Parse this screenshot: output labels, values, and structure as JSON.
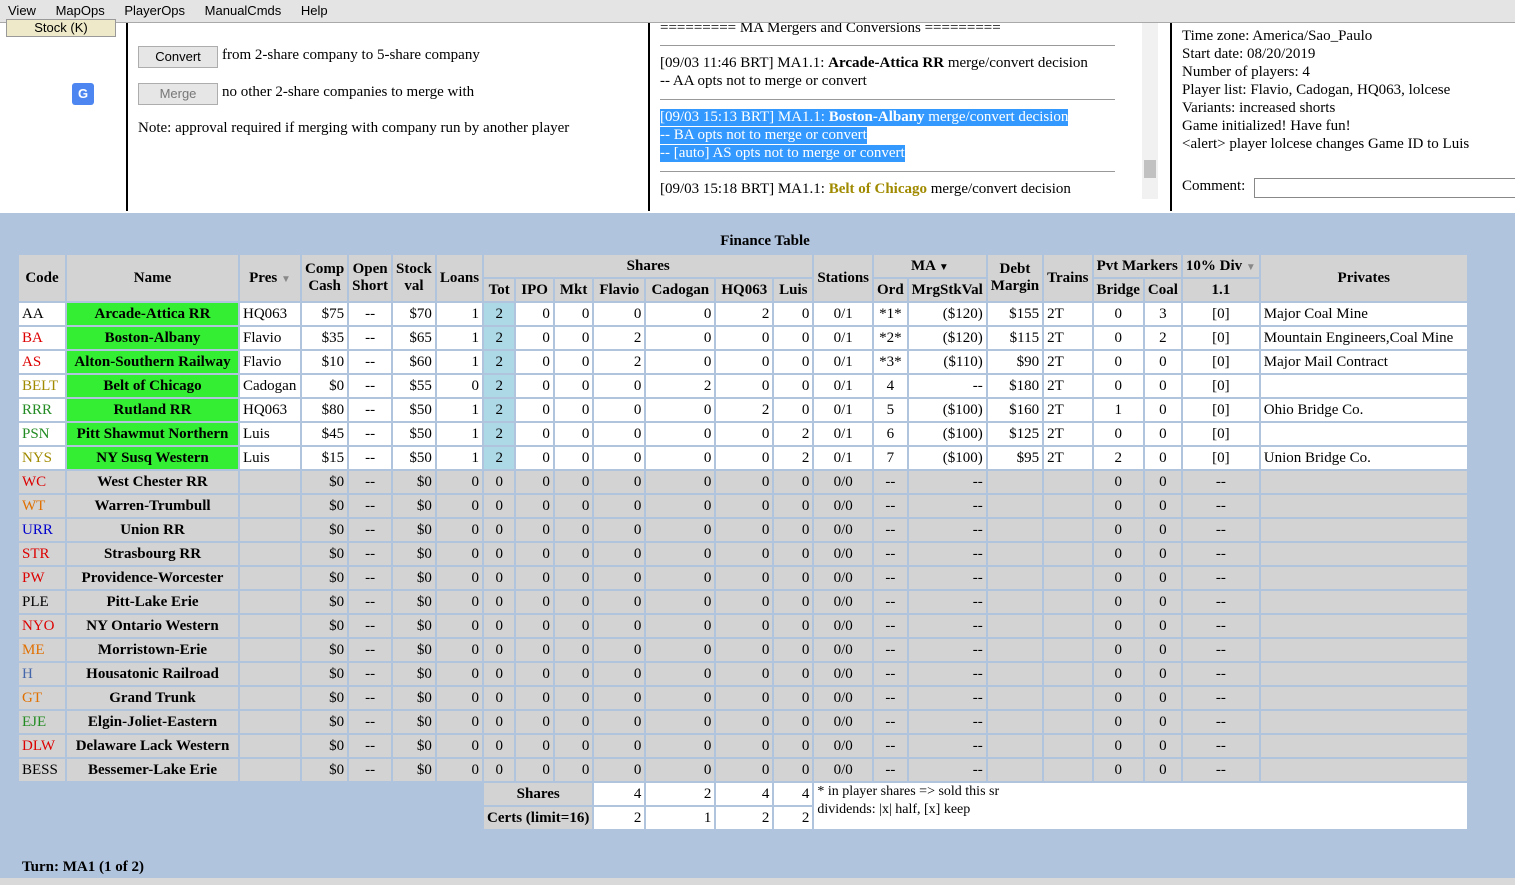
{
  "menu": [
    "View",
    "MapOps",
    "PlayerOps",
    "ManualCmds",
    "Help"
  ],
  "left": {
    "stock_button": "Stock (K)",
    "translate_icon": "G"
  },
  "mid": {
    "convert_button": "Convert",
    "convert_text": "from 2-share company to 5-share company",
    "merge_button": "Merge",
    "merge_text": "no other 2-share companies to merge with",
    "note": "Note: approval required if merging with company run by another player"
  },
  "log": {
    "header": "========= MA Mergers and Conversions =========",
    "e1_prefix": "[09/03 11:46 BRT] MA1.1: ",
    "e1_co": "Arcade-Attica RR",
    "e1_rest": " merge/convert decision",
    "e1_line2": "-- AA opts not to merge or convert",
    "e2_prefix": "[09/03 15:13 BRT] MA1.1: ",
    "e2_co": "Boston-Albany",
    "e2_rest": " merge/convert decision",
    "e2_line2": "-- BA opts not to merge or convert",
    "e2_line3": "-- [auto] AS opts not to merge or convert",
    "e3_prefix": "[09/03 15:18 BRT] MA1.1: ",
    "e3_co": "Belt of Chicago",
    "e3_rest": " merge/convert decision"
  },
  "info": {
    "timezone": "Time zone: America/Sao_Paulo",
    "start": "Start date: 08/20/2019",
    "players": "Number of players: 4",
    "list": "Player list: Flavio, Cadogan, HQ063, lolcese",
    "variants": "Variants: increased shorts",
    "init": "Game initialized! Have fun!",
    "alert": "<alert> player lolcese changes Game ID to Luis",
    "comment_label": "Comment:"
  },
  "finance": {
    "title": "Finance Table",
    "headers": {
      "code": "Code",
      "name": "Name",
      "pres": "Pres",
      "comp1": "Comp",
      "comp2": "Cash",
      "open1": "Open",
      "open2": "Short",
      "stock1": "Stock",
      "stock2": "val",
      "loans": "Loans",
      "shares": "Shares",
      "tot": "Tot",
      "ipo": "IPO",
      "mkt": "Mkt",
      "flavio": "Flavio",
      "cadogan": "Cadogan",
      "hq063": "HQ063",
      "luis": "Luis",
      "stations": "Stations",
      "ma": "MA",
      "ord": "Ord",
      "mrg": "MrgStkVal",
      "debt1": "Debt",
      "debt2": "Margin",
      "trains": "Trains",
      "pvt": "Pvt Markers",
      "bridge": "Bridge",
      "coal": "Coal",
      "div": "10% Div",
      "div_sub": "1.1",
      "privates": "Privates"
    },
    "rows": [
      {
        "code": "AA",
        "color": "#000000",
        "name": "Arcade-Attica RR",
        "pres": "HQ063",
        "cash": "$75",
        "short": "--",
        "val": "$70",
        "loans": "1",
        "tot": "2",
        "ipo": "0",
        "mkt": "0",
        "f": "0",
        "c": "0",
        "h": "2",
        "l": "0",
        "st": "0/1",
        "ord": "*1*",
        "mrg": "($120)",
        "debt": "$155",
        "trains": "2T",
        "bridge": "0",
        "coal": "3",
        "div": "[0]",
        "priv": "Major Coal Mine",
        "active": true
      },
      {
        "code": "BA",
        "color": "#dd0000",
        "name": "Boston-Albany",
        "pres": "Flavio",
        "cash": "$35",
        "short": "--",
        "val": "$65",
        "loans": "1",
        "tot": "2",
        "ipo": "0",
        "mkt": "0",
        "f": "2",
        "c": "0",
        "h": "0",
        "l": "0",
        "st": "0/1",
        "ord": "*2*",
        "mrg": "($120)",
        "debt": "$115",
        "trains": "2T",
        "bridge": "0",
        "coal": "2",
        "div": "[0]",
        "priv": "Mountain Engineers,Coal Mine",
        "active": true
      },
      {
        "code": "AS",
        "color": "#dd0000",
        "name": "Alton-Southern Railway",
        "pres": "Flavio",
        "cash": "$10",
        "short": "--",
        "val": "$60",
        "loans": "1",
        "tot": "2",
        "ipo": "0",
        "mkt": "0",
        "f": "2",
        "c": "0",
        "h": "0",
        "l": "0",
        "st": "0/1",
        "ord": "*3*",
        "mrg": "($110)",
        "debt": "$90",
        "trains": "2T",
        "bridge": "0",
        "coal": "0",
        "div": "[0]",
        "priv": "Major Mail Contract",
        "active": true
      },
      {
        "code": "BELT",
        "color": "#a08a00",
        "name": "Belt of Chicago",
        "pres": "Cadogan",
        "cash": "$0",
        "short": "--",
        "val": "$55",
        "loans": "0",
        "tot": "2",
        "ipo": "0",
        "mkt": "0",
        "f": "0",
        "c": "2",
        "h": "0",
        "l": "0",
        "st": "0/1",
        "ord": "4",
        "mrg": "--",
        "debt": "$180",
        "trains": "2T",
        "bridge": "0",
        "coal": "0",
        "div": "[0]",
        "priv": "",
        "active": true
      },
      {
        "code": "RRR",
        "color": "#228b22",
        "name": "Rutland RR",
        "pres": "HQ063",
        "cash": "$80",
        "short": "--",
        "val": "$50",
        "loans": "1",
        "tot": "2",
        "ipo": "0",
        "mkt": "0",
        "f": "0",
        "c": "0",
        "h": "2",
        "l": "0",
        "st": "0/1",
        "ord": "5",
        "mrg": "($100)",
        "debt": "$160",
        "trains": "2T",
        "bridge": "1",
        "coal": "0",
        "div": "[0]",
        "priv": "Ohio Bridge Co.",
        "active": true
      },
      {
        "code": "PSN",
        "color": "#228b22",
        "name": "Pitt Shawmut Northern",
        "pres": "Luis",
        "cash": "$45",
        "short": "--",
        "val": "$50",
        "loans": "1",
        "tot": "2",
        "ipo": "0",
        "mkt": "0",
        "f": "0",
        "c": "0",
        "h": "0",
        "l": "2",
        "st": "0/1",
        "ord": "6",
        "mrg": "($100)",
        "debt": "$125",
        "trains": "2T",
        "bridge": "0",
        "coal": "0",
        "div": "[0]",
        "priv": "",
        "active": true
      },
      {
        "code": "NYS",
        "color": "#a08a00",
        "name": "NY Susq Western",
        "pres": "Luis",
        "cash": "$15",
        "short": "--",
        "val": "$50",
        "loans": "1",
        "tot": "2",
        "ipo": "0",
        "mkt": "0",
        "f": "0",
        "c": "0",
        "h": "0",
        "l": "2",
        "st": "0/1",
        "ord": "7",
        "mrg": "($100)",
        "debt": "$95",
        "trains": "2T",
        "bridge": "2",
        "coal": "0",
        "div": "[0]",
        "priv": "Union Bridge Co.",
        "active": true
      },
      {
        "code": "WC",
        "color": "#dd0000",
        "name": "West Chester RR",
        "pres": "",
        "cash": "$0",
        "short": "--",
        "val": "$0",
        "loans": "0",
        "tot": "0",
        "ipo": "0",
        "mkt": "0",
        "f": "0",
        "c": "0",
        "h": "0",
        "l": "0",
        "st": "0/0",
        "ord": "--",
        "mrg": "--",
        "debt": "",
        "trains": "",
        "bridge": "0",
        "coal": "0",
        "div": "--",
        "priv": "",
        "active": false
      },
      {
        "code": "WT",
        "color": "#e07000",
        "name": "Warren-Trumbull",
        "pres": "",
        "cash": "$0",
        "short": "--",
        "val": "$0",
        "loans": "0",
        "tot": "0",
        "ipo": "0",
        "mkt": "0",
        "f": "0",
        "c": "0",
        "h": "0",
        "l": "0",
        "st": "0/0",
        "ord": "--",
        "mrg": "--",
        "debt": "",
        "trains": "",
        "bridge": "0",
        "coal": "0",
        "div": "--",
        "priv": "",
        "active": false
      },
      {
        "code": "URR",
        "color": "#0000cc",
        "name": "Union RR",
        "pres": "",
        "cash": "$0",
        "short": "--",
        "val": "$0",
        "loans": "0",
        "tot": "0",
        "ipo": "0",
        "mkt": "0",
        "f": "0",
        "c": "0",
        "h": "0",
        "l": "0",
        "st": "0/0",
        "ord": "--",
        "mrg": "--",
        "debt": "",
        "trains": "",
        "bridge": "0",
        "coal": "0",
        "div": "--",
        "priv": "",
        "active": false
      },
      {
        "code": "STR",
        "color": "#dd0000",
        "name": "Strasbourg RR",
        "pres": "",
        "cash": "$0",
        "short": "--",
        "val": "$0",
        "loans": "0",
        "tot": "0",
        "ipo": "0",
        "mkt": "0",
        "f": "0",
        "c": "0",
        "h": "0",
        "l": "0",
        "st": "0/0",
        "ord": "--",
        "mrg": "--",
        "debt": "",
        "trains": "",
        "bridge": "0",
        "coal": "0",
        "div": "--",
        "priv": "",
        "active": false
      },
      {
        "code": "PW",
        "color": "#dd0000",
        "name": "Providence-Worcester",
        "pres": "",
        "cash": "$0",
        "short": "--",
        "val": "$0",
        "loans": "0",
        "tot": "0",
        "ipo": "0",
        "mkt": "0",
        "f": "0",
        "c": "0",
        "h": "0",
        "l": "0",
        "st": "0/0",
        "ord": "--",
        "mrg": "--",
        "debt": "",
        "trains": "",
        "bridge": "0",
        "coal": "0",
        "div": "--",
        "priv": "",
        "active": false
      },
      {
        "code": "PLE",
        "color": "#000000",
        "name": "Pitt-Lake Erie",
        "pres": "",
        "cash": "$0",
        "short": "--",
        "val": "$0",
        "loans": "0",
        "tot": "0",
        "ipo": "0",
        "mkt": "0",
        "f": "0",
        "c": "0",
        "h": "0",
        "l": "0",
        "st": "0/0",
        "ord": "--",
        "mrg": "--",
        "debt": "",
        "trains": "",
        "bridge": "0",
        "coal": "0",
        "div": "--",
        "priv": "",
        "active": false
      },
      {
        "code": "NYO",
        "color": "#dd0000",
        "name": "NY Ontario Western",
        "pres": "",
        "cash": "$0",
        "short": "--",
        "val": "$0",
        "loans": "0",
        "tot": "0",
        "ipo": "0",
        "mkt": "0",
        "f": "0",
        "c": "0",
        "h": "0",
        "l": "0",
        "st": "0/0",
        "ord": "--",
        "mrg": "--",
        "debt": "",
        "trains": "",
        "bridge": "0",
        "coal": "0",
        "div": "--",
        "priv": "",
        "active": false
      },
      {
        "code": "ME",
        "color": "#e07000",
        "name": "Morristown-Erie",
        "pres": "",
        "cash": "$0",
        "short": "--",
        "val": "$0",
        "loans": "0",
        "tot": "0",
        "ipo": "0",
        "mkt": "0",
        "f": "0",
        "c": "0",
        "h": "0",
        "l": "0",
        "st": "0/0",
        "ord": "--",
        "mrg": "--",
        "debt": "",
        "trains": "",
        "bridge": "0",
        "coal": "0",
        "div": "--",
        "priv": "",
        "active": false
      },
      {
        "code": "H",
        "color": "#4466aa",
        "name": "Housatonic Railroad",
        "pres": "",
        "cash": "$0",
        "short": "--",
        "val": "$0",
        "loans": "0",
        "tot": "0",
        "ipo": "0",
        "mkt": "0",
        "f": "0",
        "c": "0",
        "h": "0",
        "l": "0",
        "st": "0/0",
        "ord": "--",
        "mrg": "--",
        "debt": "",
        "trains": "",
        "bridge": "0",
        "coal": "0",
        "div": "--",
        "priv": "",
        "active": false
      },
      {
        "code": "GT",
        "color": "#e07000",
        "name": "Grand Trunk",
        "pres": "",
        "cash": "$0",
        "short": "--",
        "val": "$0",
        "loans": "0",
        "tot": "0",
        "ipo": "0",
        "mkt": "0",
        "f": "0",
        "c": "0",
        "h": "0",
        "l": "0",
        "st": "0/0",
        "ord": "--",
        "mrg": "--",
        "debt": "",
        "trains": "",
        "bridge": "0",
        "coal": "0",
        "div": "--",
        "priv": "",
        "active": false
      },
      {
        "code": "EJE",
        "color": "#228b22",
        "name": "Elgin-Joliet-Eastern",
        "pres": "",
        "cash": "$0",
        "short": "--",
        "val": "$0",
        "loans": "0",
        "tot": "0",
        "ipo": "0",
        "mkt": "0",
        "f": "0",
        "c": "0",
        "h": "0",
        "l": "0",
        "st": "0/0",
        "ord": "--",
        "mrg": "--",
        "debt": "",
        "trains": "",
        "bridge": "0",
        "coal": "0",
        "div": "--",
        "priv": "",
        "active": false
      },
      {
        "code": "DLW",
        "color": "#dd0000",
        "name": "Delaware Lack Western",
        "pres": "",
        "cash": "$0",
        "short": "--",
        "val": "$0",
        "loans": "0",
        "tot": "0",
        "ipo": "0",
        "mkt": "0",
        "f": "0",
        "c": "0",
        "h": "0",
        "l": "0",
        "st": "0/0",
        "ord": "--",
        "mrg": "--",
        "debt": "",
        "trains": "",
        "bridge": "0",
        "coal": "0",
        "div": "--",
        "priv": "",
        "active": false
      },
      {
        "code": "BESS",
        "color": "#000000",
        "name": "Bessemer-Lake Erie",
        "pres": "",
        "cash": "$0",
        "short": "--",
        "val": "$0",
        "loans": "0",
        "tot": "0",
        "ipo": "0",
        "mkt": "0",
        "f": "0",
        "c": "0",
        "h": "0",
        "l": "0",
        "st": "0/0",
        "ord": "--",
        "mrg": "--",
        "debt": "",
        "trains": "",
        "bridge": "0",
        "coal": "0",
        "div": "--",
        "priv": "",
        "active": false
      }
    ],
    "summary": {
      "shares_label": "Shares",
      "shares": [
        "4",
        "2",
        "4",
        "4"
      ],
      "certs_label": "Certs (limit=16)",
      "certs": [
        "2",
        "1",
        "2",
        "2"
      ],
      "note1": "* in player shares => sold this sr",
      "note2": "dividends: |x| half, [x] keep"
    },
    "turn": "Turn: MA1 (1 of 2)"
  }
}
